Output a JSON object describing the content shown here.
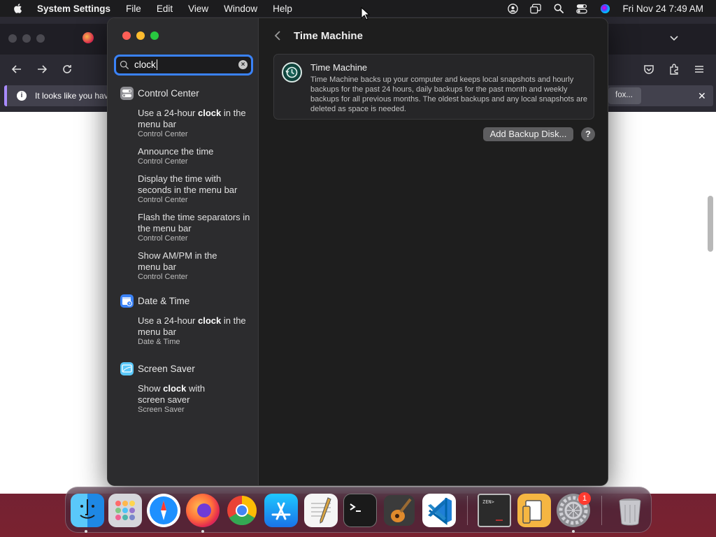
{
  "menubar": {
    "app_name": "System Settings",
    "menus": [
      "File",
      "Edit",
      "View",
      "Window",
      "Help"
    ],
    "clock": "Fri Nov 24  7:49 AM",
    "status_icons": [
      "user-icon",
      "display-icon",
      "spotlight-icon",
      "control-center-icon",
      "siri-icon"
    ]
  },
  "browser": {
    "notification_text": "It looks like you have",
    "notification_button": "fox...",
    "close": "✕"
  },
  "sidebar": {
    "search": {
      "value": "clock",
      "placeholder": "Search"
    },
    "groups": [
      {
        "title": "Control Center",
        "icon": "control-center-icon",
        "color": "#8e8e93",
        "results": [
          {
            "pre": "Use a 24-hour ",
            "match": "clock",
            "post": " in the menu bar",
            "sub": "Control Center"
          },
          {
            "pre": "Announce the time",
            "match": "",
            "post": "",
            "sub": "Control Center"
          },
          {
            "pre": "Display the time with seconds in the menu bar",
            "match": "",
            "post": "",
            "sub": "Control Center"
          },
          {
            "pre": "Flash the time separators in the menu bar",
            "match": "",
            "post": "",
            "sub": "Control Center"
          },
          {
            "pre": "Show AM/PM in the menu bar",
            "match": "",
            "post": "",
            "sub": "Control Center"
          }
        ]
      },
      {
        "title": "Date & Time",
        "icon": "calendar-clock-icon",
        "color": "#3a82f7",
        "results": [
          {
            "pre": "Use a 24-hour ",
            "match": "clock",
            "post": " in the menu bar",
            "sub": "Date & Time"
          }
        ]
      },
      {
        "title": "Screen Saver",
        "icon": "screen-saver-icon",
        "color": "#5ac8fa",
        "results": [
          {
            "pre": "Show ",
            "match": "clock",
            "post": " with screen saver",
            "sub": "Screen Saver"
          }
        ]
      }
    ]
  },
  "main": {
    "title": "Time Machine",
    "card_title": "Time Machine",
    "card_desc": "Time Machine backs up your computer and keeps local snapshots and hourly backups for the past 24 hours, daily backups for the past month and weekly backups for all previous months. The oldest backups and any local snapshots are deleted as space is needed.",
    "add_button": "Add Backup Disk...",
    "help_button": "?"
  },
  "dock": {
    "items": [
      "finder-icon",
      "launchpad-icon",
      "safari-icon",
      "firefox-icon",
      "chrome-icon",
      "app-store-icon",
      "textedit-icon",
      "terminal-icon",
      "garageband-icon",
      "vscode-icon",
      "zenmap-icon",
      "preview-icon",
      "system-settings-icon",
      "trash-icon"
    ],
    "settings_badge": "1"
  }
}
